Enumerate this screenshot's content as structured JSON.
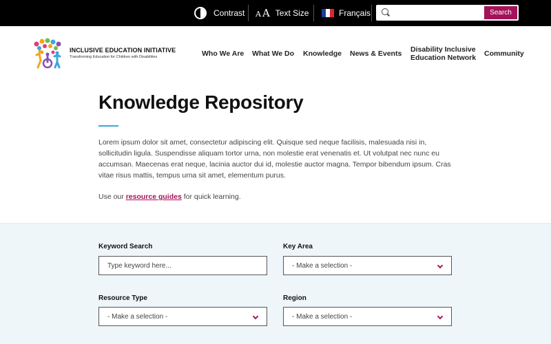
{
  "topbar": {
    "contrast_label": "Contrast",
    "text_size_label": "Text Size",
    "text_size_icon_small": "A",
    "text_size_icon_big": "A",
    "language_label": "Français",
    "search_placeholder": "",
    "search_button_label": "Search",
    "flag_colors": [
      "#1f3c96",
      "#ffffff",
      "#e0242e"
    ]
  },
  "logo": {
    "title": "INCLUSIVE EDUCATION INITIATIVE",
    "subtitle": "Transforming Education for Children with Disabilities"
  },
  "nav": {
    "who_we_are": "Who We Are",
    "what_we_do": "What We Do",
    "knowledge": "Knowledge",
    "news_events": "News & Events",
    "disability_line1": "Disability Inclusive",
    "disability_line2": "Education Network",
    "community": "Community"
  },
  "hero": {
    "title": "Knowledge Repository",
    "intro": "Lorem ipsum dolor sit amet, consectetur adipiscing elit. Quisque sed neque facilisis, malesuada nisi in, sollicitudin ligula. Suspendisse aliquam tortor urna, non molestie erat venenatis et. Ut volutpat nec nunc eu accumsan. Maecenas erat neque, lacinia auctor dui id, molestie auctor magna. Tempor bibendum ipsum. Cras vitae risus mattis, tempus urna sit amet, elementum purus.",
    "resource_prefix": "Use our ",
    "resource_link": "resource guides",
    "resource_suffix": " for quick learning."
  },
  "filters": {
    "keyword_label": "Keyword Search",
    "keyword_placeholder": "Type keyword here...",
    "key_area_label": "Key Area",
    "key_area_value": "- Make a selection -",
    "resource_type_label": "Resource Type",
    "resource_type_value": "- Make a selection -",
    "region_label": "Region",
    "region_value": "- Make a selection -"
  },
  "colors": {
    "accent": "#a4135a",
    "underline": "#36a9d6",
    "filter_bg": "#eef6fa",
    "topbar_bg": "#000000"
  }
}
